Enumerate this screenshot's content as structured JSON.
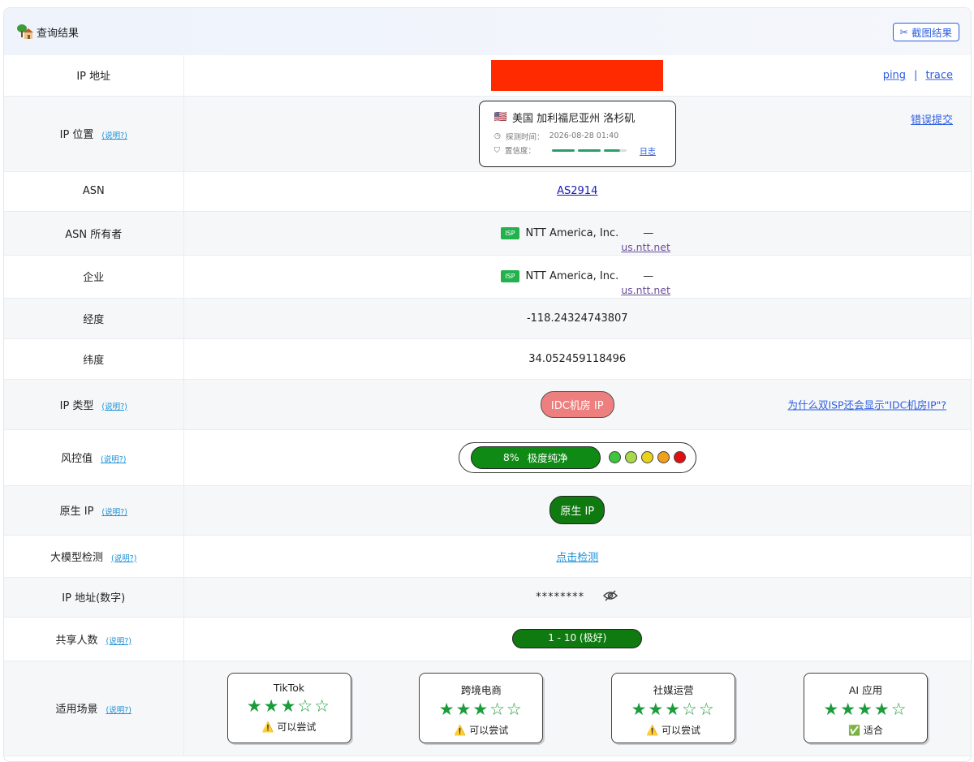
{
  "header": {
    "title": "查询结果",
    "screenshot_button": "截图结果"
  },
  "note_label": "(说明?)",
  "rows": {
    "ip_address": {
      "label": "IP 地址",
      "ping": "ping",
      "sep": "|",
      "trace": "trace"
    },
    "ip_location": {
      "label": "IP 位置",
      "flag": "🇺🇸",
      "location": "美国 加利福尼亚州 洛杉矶",
      "detect_time_label": "探测时间：",
      "detect_time": "2026-08-28 01:40",
      "confidence_label": "置信度：",
      "confidence_level": 0.92,
      "log_link": "日志",
      "error_link": "错误提交"
    },
    "asn": {
      "label": "ASN",
      "value": "AS2914"
    },
    "asn_owner": {
      "label": "ASN 所有者",
      "badge": "ISP",
      "name": "NTT America, Inc.",
      "dash": "—",
      "site": "us.ntt.net"
    },
    "company": {
      "label": "企业",
      "badge": "ISP",
      "name": "NTT America, Inc.",
      "dash": "—",
      "site": "us.ntt.net"
    },
    "longitude": {
      "label": "经度",
      "value": "-118.24324743807"
    },
    "latitude": {
      "label": "纬度",
      "value": "34.052459118496"
    },
    "ip_type": {
      "label": "IP 类型",
      "value": "IDC机房 IP",
      "why_link": "为什么双ISP还会显示\"IDC机房IP\"?"
    },
    "risk": {
      "label": "风控值",
      "percent": "8%",
      "level_text": "极度纯净",
      "dot_colors": [
        "#3cc63c",
        "#a9d94a",
        "#e8d21a",
        "#f0a01a",
        "#e01010"
      ]
    },
    "native_ip": {
      "label": "原生 IP",
      "value": "原生 IP"
    },
    "llm_check": {
      "label": "大模型检测",
      "link": "点击检测"
    },
    "ip_numeric": {
      "label": "IP 地址(数字)",
      "value": "********"
    },
    "shared_users": {
      "label": "共享人数",
      "value": "1 - 10 (极好)"
    },
    "scenarios": {
      "label": "适用场景",
      "cards": [
        {
          "title": "TikTok",
          "stars": "★★★☆☆",
          "rating": 3,
          "status_icon": "⚠️",
          "status": "可以尝试"
        },
        {
          "title": "跨境电商",
          "stars": "★★★☆☆",
          "rating": 3,
          "status_icon": "⚠️",
          "status": "可以尝试"
        },
        {
          "title": "社媒运营",
          "stars": "★★★☆☆",
          "rating": 3,
          "status_icon": "⚠️",
          "status": "可以尝试"
        },
        {
          "title": "AI 应用",
          "stars": "★★★★☆",
          "rating": 4,
          "status_icon": "✅",
          "status": "适合"
        }
      ]
    }
  }
}
